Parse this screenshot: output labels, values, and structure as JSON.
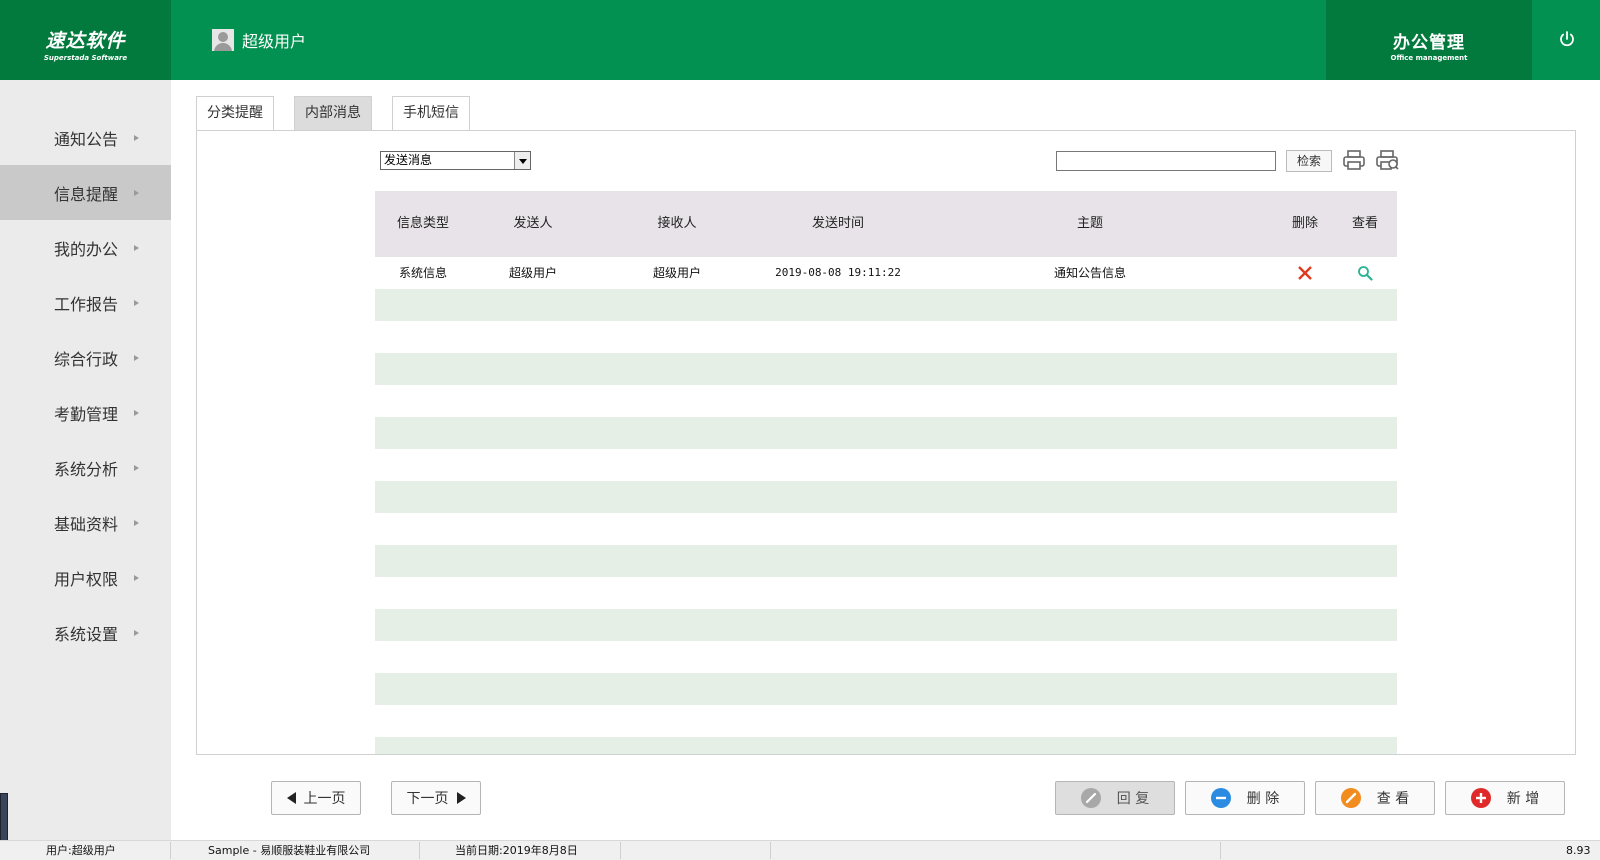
{
  "header": {
    "logo_cn": "速达软件",
    "logo_en": "Superstada Software",
    "user_name": "超级用户",
    "module_cn": "办公管理",
    "module_en": "Office management",
    "power_icon": "power-icon"
  },
  "sidebar": {
    "items": [
      {
        "label": "通知公告"
      },
      {
        "label": "信息提醒"
      },
      {
        "label": "我的办公"
      },
      {
        "label": "工作报告"
      },
      {
        "label": "综合行政"
      },
      {
        "label": "考勤管理"
      },
      {
        "label": "系统分析"
      },
      {
        "label": "基础资料"
      },
      {
        "label": "用户权限"
      },
      {
        "label": "系统设置"
      }
    ],
    "active": "信息提醒"
  },
  "tabs": [
    {
      "label": "分类提醒"
    },
    {
      "label": "内部消息"
    },
    {
      "label": "手机短信"
    }
  ],
  "toolbar": {
    "select_value": "发送消息",
    "search_value": "",
    "search_label": "检索",
    "print_icon": "print-icon",
    "print_preview_icon": "print-preview-icon"
  },
  "table": {
    "headers": {
      "type": "信息类型",
      "sender": "发送人",
      "receiver": "接收人",
      "time": "发送时间",
      "subject": "主题",
      "delete": "删除",
      "view": "查看"
    },
    "rows": [
      {
        "type": "系统信息",
        "sender": "超级用户",
        "receiver": "超级用户",
        "time": "2019-08-08 19:11:22",
        "subject": "通知公告信息"
      }
    ]
  },
  "buttons": {
    "prev": "上一页",
    "next": "下一页",
    "reply": "回 复",
    "delete": "删 除",
    "view": "查 看",
    "add": "新 增"
  },
  "colors": {
    "header_green": "#029150",
    "header_dark_green": "#027a3e",
    "row_alt": "#e6efe5",
    "delete_red": "#e03a1e",
    "view_teal": "#29b393"
  },
  "status": {
    "user": "用户:超级用户",
    "company": "Sample - 易顺服装鞋业有限公司",
    "date": "当前日期:2019年8月8日",
    "version": "8.93"
  }
}
